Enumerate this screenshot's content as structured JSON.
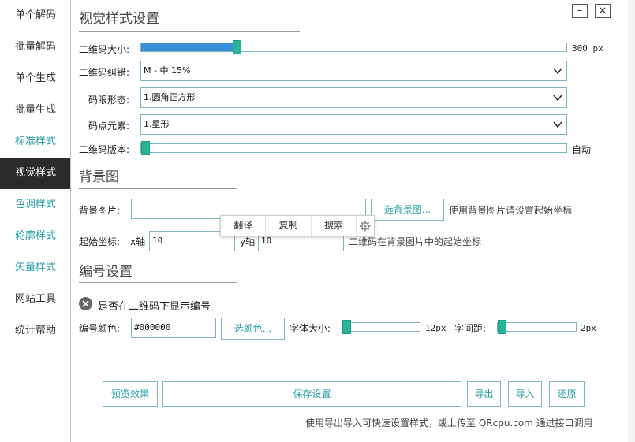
{
  "sidebar": {
    "items": [
      {
        "label": "单个解码",
        "style": "normal"
      },
      {
        "label": "批量解码",
        "style": "normal"
      },
      {
        "label": "单个生成",
        "style": "normal"
      },
      {
        "label": "批量生成",
        "style": "normal"
      },
      {
        "label": "标准样式",
        "style": "teal"
      },
      {
        "label": "视觉样式",
        "style": "active"
      },
      {
        "label": "色调样式",
        "style": "teal"
      },
      {
        "label": "轮廓样式",
        "style": "teal"
      },
      {
        "label": "矢量样式",
        "style": "teal"
      },
      {
        "label": "网站工具",
        "style": "normal"
      },
      {
        "label": "统计帮助",
        "style": "normal"
      }
    ]
  },
  "window": {
    "minimize_label": "–",
    "close_label": "×"
  },
  "visual": {
    "title": "视觉样式设置",
    "size": {
      "label": "二维码大小:",
      "value_text": "300 px",
      "fraction": 0.22
    },
    "ecc": {
      "label": "二维码纠错:",
      "selected": "M - 中 15%"
    },
    "eye": {
      "label": "码眼形态:",
      "selected": "1.圆角正方形"
    },
    "dot": {
      "label": "码点元素:",
      "selected": "1.星形"
    },
    "version": {
      "label": "二维码版本:",
      "value_text": "自动",
      "fraction": 0.0
    }
  },
  "background": {
    "title": "背景图",
    "image_label": "背景图片:",
    "image_value": "",
    "choose_button": "选背景图...",
    "image_hint": "使用背景图片请设置起始坐标",
    "start_label": "起始坐标:",
    "x_label": "x轴",
    "x_value": "10",
    "y_label": "y轴",
    "y_value": "10",
    "start_hint": "二维码在背景图片中的起始坐标"
  },
  "popup": {
    "translate": "翻译",
    "copy": "复制",
    "search": "搜索"
  },
  "numbering": {
    "title": "编号设置",
    "show_label": "是否在二维码下显示编号",
    "color_label": "编号颜色:",
    "color_value": "#000000",
    "color_button": "选颜色...",
    "font_size_label": "字体大小:",
    "font_size_value": "12px",
    "font_size_fraction": 0.0,
    "spacing_label": "字间距:",
    "spacing_value": "2px",
    "spacing_fraction": 0.0
  },
  "actions": {
    "preview": "预览效果",
    "save": "保存设置",
    "export": "导出",
    "import": "导入",
    "restore": "还原"
  },
  "footer_note": "使用导出导入可快速设置样式，或上传至 QRcpu.com 通过接口调用",
  "colors": {
    "accent": "#2aa0a5",
    "thumb": "#26b597",
    "fill": "#3a8fd6",
    "active_bg": "#2b2b2b"
  }
}
